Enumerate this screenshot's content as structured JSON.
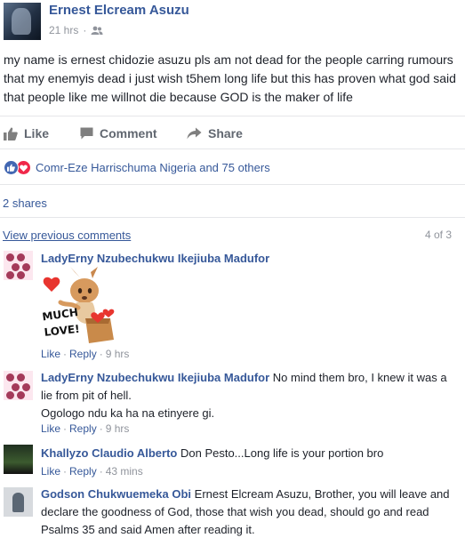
{
  "post": {
    "author": "Ernest Elcream Asuzu",
    "time": "21 hrs",
    "privacy_icon": "friends-icon",
    "text": "my name is ernest chidozie asuzu pls am not dead for the people carring rumours that my enemyis dead i just wish t5hem long life but this has proven what god said that people like me willnot die because GOD is the maker of life"
  },
  "actions": {
    "like": "Like",
    "comment": "Comment",
    "share": "Share"
  },
  "reactions": {
    "text": "Comr-Eze Harrischuma Nigeria and 75 others"
  },
  "shares": "2 shares",
  "comments_header": {
    "view_previous": "View previous comments",
    "count": "4 of 3"
  },
  "comments": [
    {
      "author": "LadyErny Nzubechukwu Ikejiuba Madufor",
      "text": "",
      "sticker_text": "MUCH LOVE!",
      "like": "Like",
      "reply": "Reply",
      "time": "9 hrs"
    },
    {
      "author": "LadyErny Nzubechukwu Ikejiuba Madufor",
      "text": "No mind them bro, I knew it was a lie from pit of hell.",
      "text2": "Ogologo ndu ka ha na etinyere gi.",
      "like": "Like",
      "reply": "Reply",
      "time": "9 hrs"
    },
    {
      "author": "Khallyzo Claudio Alberto",
      "text": "Don Pesto...Long life is your portion bro",
      "like": "Like",
      "reply": "Reply",
      "time": "43 mins"
    },
    {
      "author": "Godson Chukwuemeka Obi",
      "text": "Ernest Elcream Asuzu, Brother, you will leave and declare the goodness of God, those that wish you dead, should go and read Psalms 35 and said Amen after reading it."
    }
  ],
  "colors": {
    "link": "#365899",
    "like_blue": "#4267b2",
    "love_red": "#f0284a",
    "grey": "#90949c"
  }
}
